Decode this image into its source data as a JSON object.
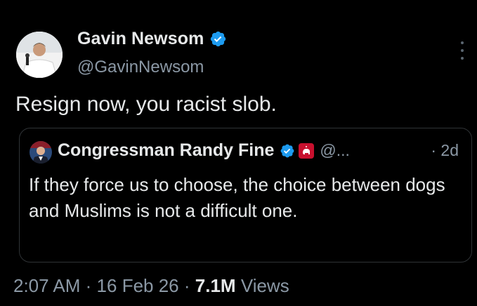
{
  "tweet": {
    "author": {
      "display_name": "Gavin Newsom",
      "handle": "@GavinNewsom",
      "verified": true,
      "avatar_icon": "person-with-microphone-avatar"
    },
    "text": "Resign now, you racist slob.",
    "more_icon": "vertical-ellipsis-icon",
    "quoted": {
      "author": {
        "display_name": "Congressman Randy Fine",
        "handle": "@...",
        "verified": true,
        "affiliation_icon": "house-gop-badge-icon",
        "avatar_icon": "portrait-avatar"
      },
      "time": "· 2d",
      "text": "If they force us to choose, the choice between dogs and Muslims is not a difficult one."
    },
    "meta": {
      "time": "2:07 AM",
      "sep1": "·",
      "date": "16 Feb 26",
      "sep2": "·",
      "views_count": "7.1M",
      "views_label": "Views"
    }
  },
  "colors": {
    "background": "#000000",
    "primary_text": "#e7e9ea",
    "secondary_text": "#8b98a5",
    "verified_blue": "#1d9bf0",
    "border": "#2f3336",
    "affiliation_red": "#c8102e"
  }
}
